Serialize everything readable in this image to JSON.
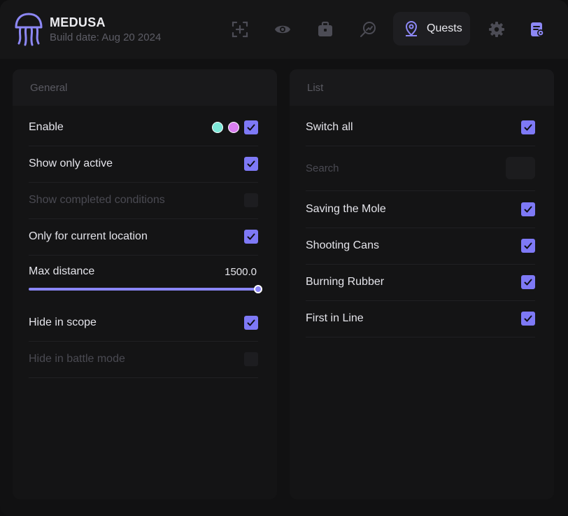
{
  "app": {
    "title": "MEDUSA",
    "build": "Build date: Aug 20 2024"
  },
  "nav": {
    "items": [
      "crosshair-plus-icon",
      "eye-icon",
      "briefcase-icon",
      "search-analytics-icon",
      "map-pin-icon",
      "gear-icon",
      "notes-settings-icon"
    ],
    "active_label": "Quests"
  },
  "colors": {
    "accent": "#7e79f6",
    "dot_teal": "#7ee8d8",
    "dot_pink": "#d97ef0"
  },
  "general": {
    "title": "General",
    "enable": {
      "label": "Enable",
      "checked": true
    },
    "show_only_active": {
      "label": "Show only active",
      "checked": true
    },
    "show_completed": {
      "label": "Show completed conditions",
      "checked": false
    },
    "only_current_location": {
      "label": "Only for current location",
      "checked": true
    },
    "max_distance": {
      "label": "Max distance",
      "value": "1500.0",
      "fraction": 1.0
    },
    "hide_in_scope": {
      "label": "Hide in scope",
      "checked": true
    },
    "hide_in_battle": {
      "label": "Hide in battle mode",
      "checked": false
    }
  },
  "list": {
    "title": "List",
    "switch_all": {
      "label": "Switch all",
      "checked": true
    },
    "search_placeholder": "Search",
    "quests": [
      {
        "label": "Saving the Mole",
        "checked": true
      },
      {
        "label": "Shooting Cans",
        "checked": true
      },
      {
        "label": "Burning Rubber",
        "checked": true
      },
      {
        "label": "First in Line",
        "checked": true
      }
    ]
  }
}
